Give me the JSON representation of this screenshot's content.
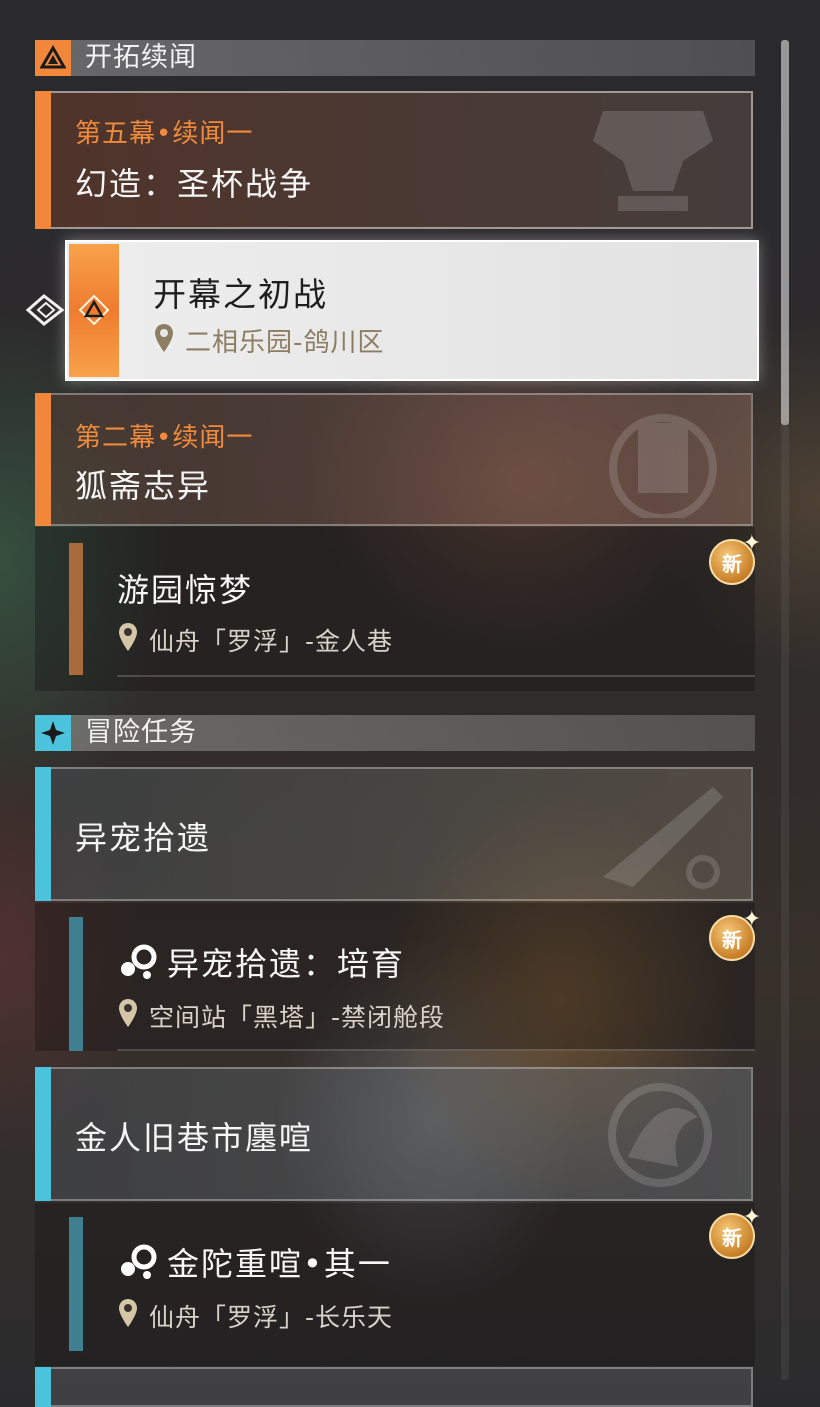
{
  "sections": {
    "trailblaze": {
      "title": "开拓续闻"
    },
    "adventure": {
      "title": "冒险任务"
    }
  },
  "chapters": [
    {
      "subtitle": "第五幕•续闻一",
      "title": "幻造：圣杯战争"
    },
    {
      "subtitle": "第二幕•续闻一",
      "title": "狐斋志异"
    }
  ],
  "selected_quest": {
    "title": "开幕之初战",
    "location": "二相乐园-鸽川区"
  },
  "quests": [
    {
      "title": "游园惊梦",
      "location": "仙舟「罗浮」-金人巷",
      "badge": "新"
    },
    {
      "title": "异宠拾遗：培育",
      "location": "空间站「黑塔」-禁闭舱段",
      "badge": "新"
    },
    {
      "title": "金陀重喧•其一",
      "location": "仙舟「罗浮」-长乐天",
      "badge": "新"
    }
  ],
  "adventure_groups": [
    {
      "title": "异宠拾遗"
    },
    {
      "title": "金人旧巷市廛喧"
    }
  ],
  "colors": {
    "trailblaze_accent": "#f0873a",
    "adventure_accent": "#4cc3dc",
    "quest_bar_orange": "#a96a3c",
    "quest_bar_teal": "#3f7f8f"
  },
  "icons": {
    "trailblaze_header": "triangle-emblem-icon",
    "adventure_header": "four-point-star-icon",
    "selected_pointer": "pointer-arrow-icon",
    "location": "location-pin-icon",
    "companion_quest": "companion-quest-icon"
  }
}
